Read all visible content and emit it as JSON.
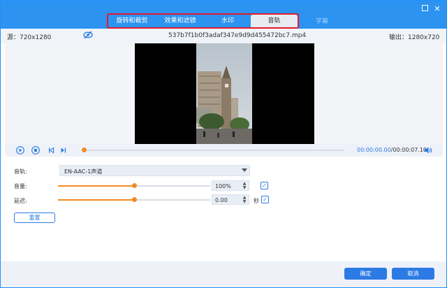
{
  "tabs": [
    "旋转和裁剪",
    "效果和滤镜",
    "水印",
    "音轨"
  ],
  "tab_extra": "字幕",
  "active_tab": "音轨",
  "info": {
    "source": "源：720x1280",
    "filename": "537b7f1b0f3adaf347e9d9d455472bc7.mp4",
    "output": "输出：1280x720"
  },
  "player": {
    "current_time": "00:00:00.00",
    "duration": "/00:00:07.10",
    "progress": 0
  },
  "audio": {
    "track_label": "音轨:",
    "track_value": "EN-AAC-1声道",
    "volume_label": "音量:",
    "volume_value": "100%",
    "volume_level": 0.5,
    "delay_label": "延迟:",
    "delay_value": "0.00",
    "delay_level": 0.5,
    "delay_unit": "秒",
    "reset": "重置"
  },
  "footer": {
    "ok": "确定",
    "cancel": "取消"
  },
  "colors": {
    "accent": "#2c7be5",
    "titlebar": "#2c93f0",
    "highlight": "#e21b2b",
    "slider": "#f28b22"
  }
}
